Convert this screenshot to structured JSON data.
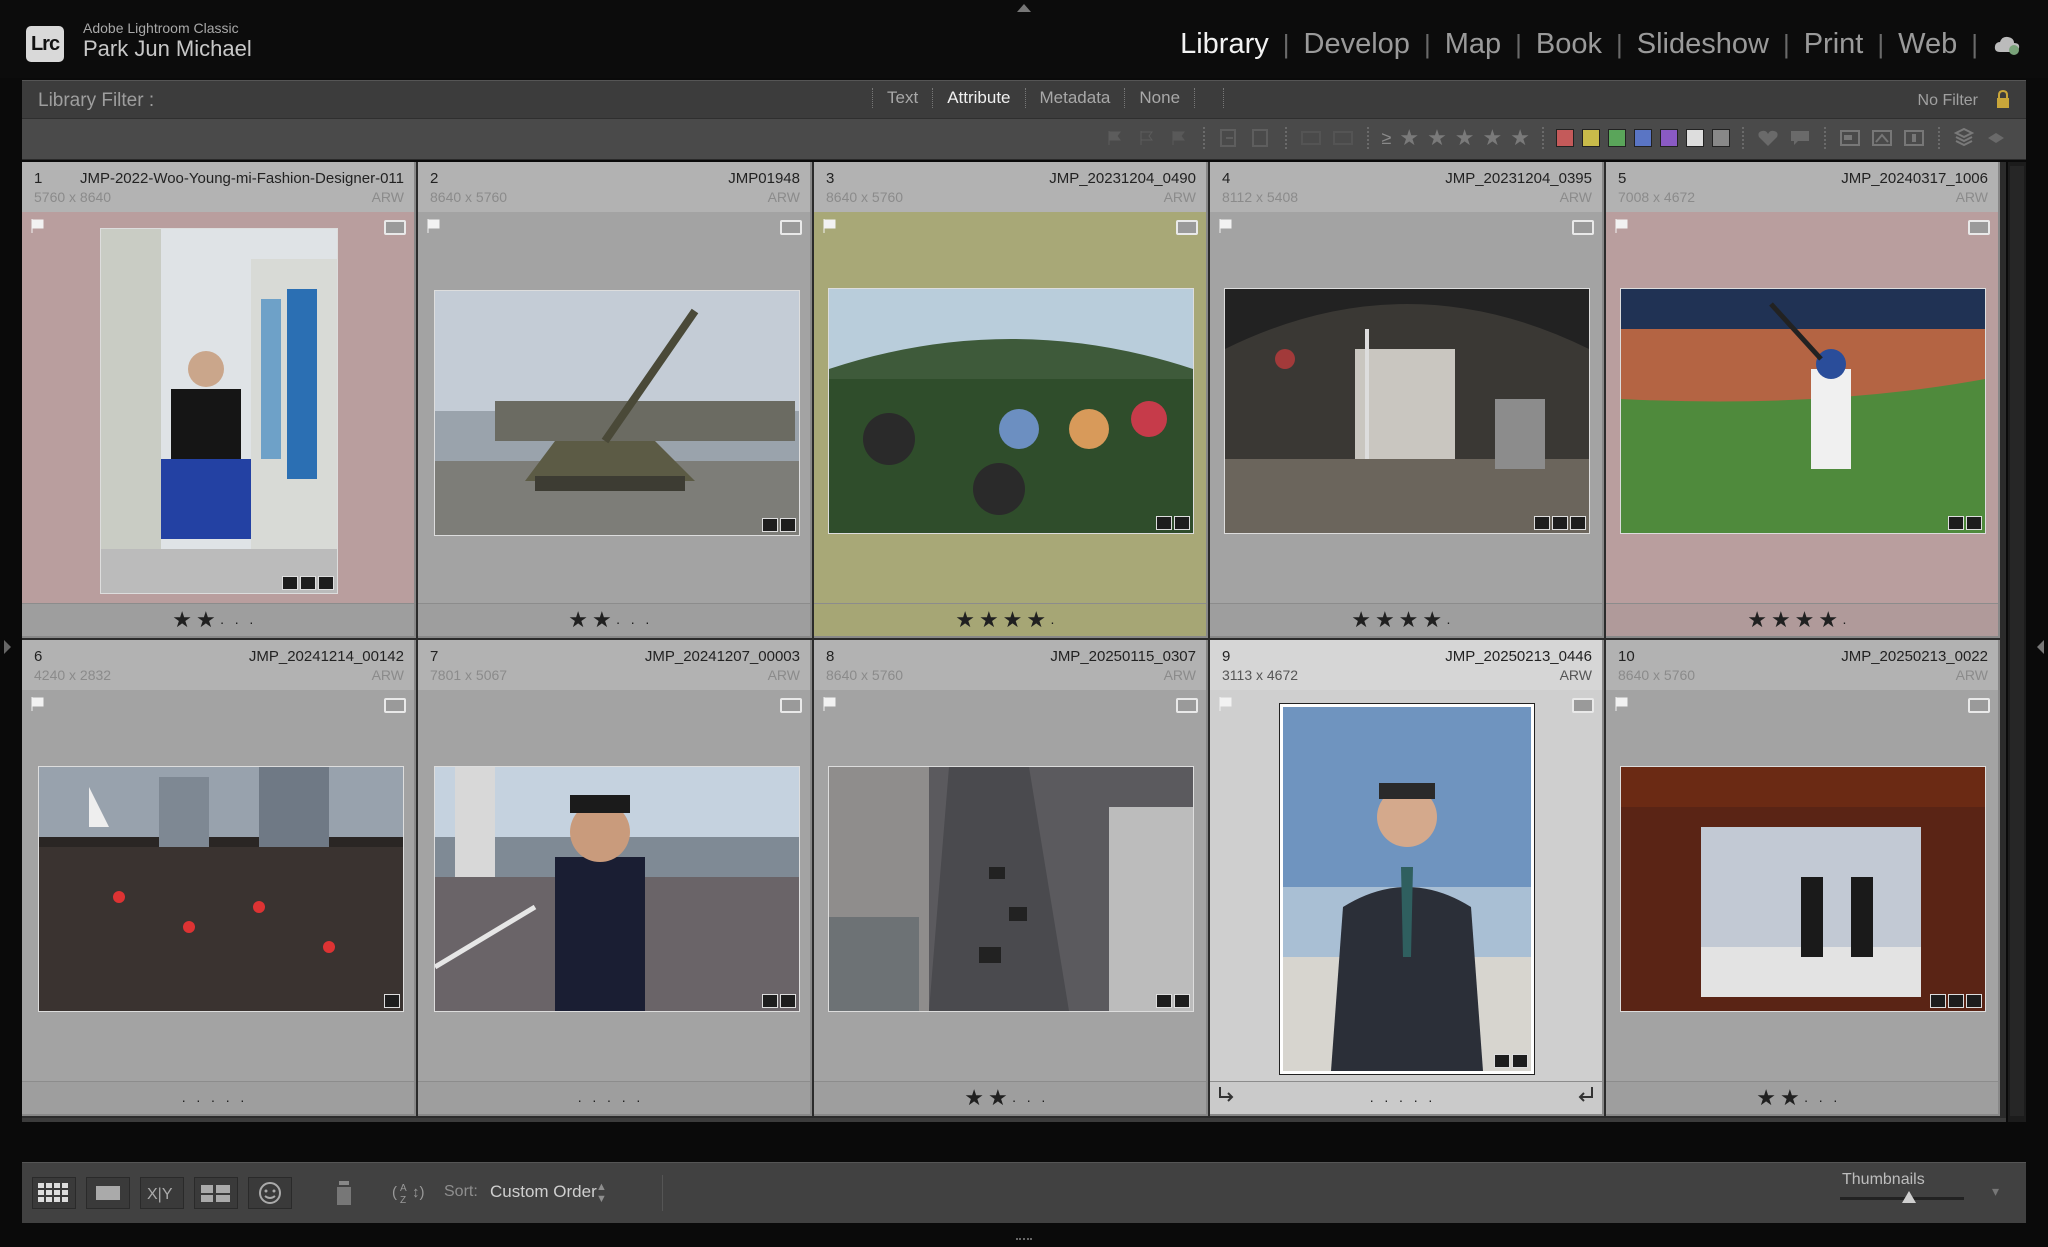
{
  "identity": {
    "app_name": "Adobe Lightroom Classic",
    "user_name": "Park Jun Michael",
    "logo": "Lrc"
  },
  "modules": [
    {
      "label": "Library",
      "active": true
    },
    {
      "label": "Develop",
      "active": false
    },
    {
      "label": "Map",
      "active": false
    },
    {
      "label": "Book",
      "active": false
    },
    {
      "label": "Slideshow",
      "active": false
    },
    {
      "label": "Print",
      "active": false
    },
    {
      "label": "Web",
      "active": false
    }
  ],
  "filter": {
    "label": "Library Filter :",
    "tabs": [
      "Text",
      "Attribute",
      "Metadata",
      "None"
    ],
    "active_tab": "Attribute",
    "preset": "No Filter",
    "rating_operator": "≥",
    "color_labels": [
      "#c45a5a",
      "#c9bb4a",
      "#5aa55a",
      "#5a75c4",
      "#8a5ac4",
      "#dddddd",
      "#888888"
    ]
  },
  "photos": [
    {
      "index": "1",
      "file": "JMP-2022-Woo-Young-mi-Fashion-Designer-011",
      "dims": "5760 x 8640",
      "ext": "ARW",
      "stars": 2,
      "label": "red",
      "orientation": "portrait"
    },
    {
      "index": "2",
      "file": "JMP01948",
      "dims": "8640 x 5760",
      "ext": "ARW",
      "stars": 2,
      "label": "none",
      "orientation": "landscape"
    },
    {
      "index": "3",
      "file": "JMP_20231204_0490",
      "dims": "8640 x 5760",
      "ext": "ARW",
      "stars": 4,
      "label": "yellow",
      "orientation": "landscape"
    },
    {
      "index": "4",
      "file": "JMP_20231204_0395",
      "dims": "8112 x 5408",
      "ext": "ARW",
      "stars": 4,
      "label": "none",
      "orientation": "landscape"
    },
    {
      "index": "5",
      "file": "JMP_20240317_1006",
      "dims": "7008 x 4672",
      "ext": "ARW",
      "stars": 4,
      "label": "red",
      "orientation": "landscape"
    },
    {
      "index": "6",
      "file": "JMP_20241214_00142",
      "dims": "4240 x 2832",
      "ext": "ARW",
      "stars": 0,
      "label": "none",
      "orientation": "landscape"
    },
    {
      "index": "7",
      "file": "JMP_20241207_00003",
      "dims": "7801 x 5067",
      "ext": "ARW",
      "stars": 0,
      "label": "none",
      "orientation": "landscape"
    },
    {
      "index": "8",
      "file": "JMP_20250115_0307",
      "dims": "8640 x 5760",
      "ext": "ARW",
      "stars": 2,
      "label": "none",
      "orientation": "landscape"
    },
    {
      "index": "9",
      "file": "JMP_20250213_0446",
      "dims": "3113 x 4672",
      "ext": "ARW",
      "stars": 0,
      "label": "none",
      "orientation": "portrait",
      "selected": true
    },
    {
      "index": "10",
      "file": "JMP_20250213_0022",
      "dims": "8640 x 5760",
      "ext": "ARW",
      "stars": 2,
      "label": "none",
      "orientation": "landscape"
    }
  ],
  "bottom": {
    "sort_label": "Sort:",
    "sort_value": "Custom Order",
    "thumbnails_label": "Thumbnails",
    "thumbnail_size": 0.56
  }
}
